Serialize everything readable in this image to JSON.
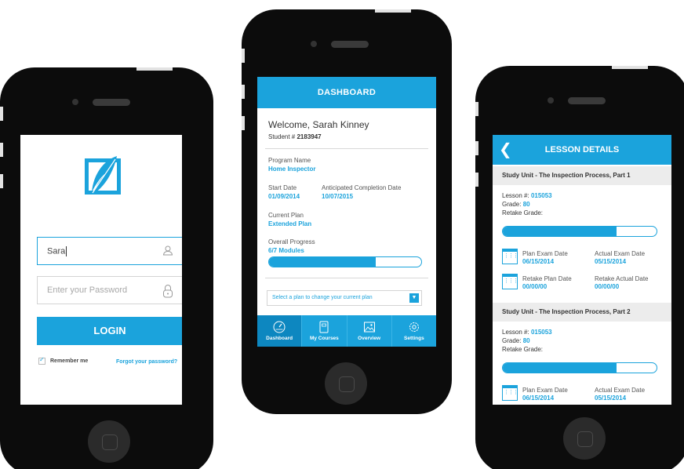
{
  "login": {
    "username_value": "Sara",
    "password_placeholder": "Enter your Password",
    "login_button": "LOGIN",
    "remember_me": "Remember me",
    "forgot_password": "Forgot your password?"
  },
  "dashboard": {
    "title": "DASHBOARD",
    "welcome": "Welcome, Sarah Kinney",
    "student_label": "Student #",
    "student_number": "2183947",
    "program_label": "Program Name",
    "program_value": "Home Inspector",
    "start_label": "Start Date",
    "start_value": "01/09/2014",
    "completion_label": "Anticipated Completion Date",
    "completion_value": "10/07/2015",
    "plan_label": "Current Plan",
    "plan_value": "Extended Plan",
    "progress_label": "Overall Progress",
    "progress_value": "6/7 Modules",
    "progress_fraction": 0.7,
    "select_placeholder": "Select a plan to change your current plan",
    "tabs": [
      {
        "label": "Dashboard",
        "icon": "gauge-icon",
        "active": true
      },
      {
        "label": "My Courses",
        "icon": "book-icon",
        "active": false
      },
      {
        "label": "Overview",
        "icon": "picture-icon",
        "active": false
      },
      {
        "label": "Settings",
        "icon": "gear-icon",
        "active": false
      }
    ]
  },
  "lesson": {
    "title": "LESSON DETAILS",
    "units": [
      {
        "name": "Study Unit - The Inspection Process, Part 1",
        "lesson_label": "Lesson #:",
        "lesson_number": "015053",
        "grade_label": "Grade:",
        "grade": "80",
        "retake_label": "Retake Grade:",
        "progress_fraction": 0.74,
        "plan_exam_label": "Plan Exam Date",
        "plan_exam_date": "06/15/2014",
        "actual_exam_label": "Actual Exam Date",
        "actual_exam_date": "05/15/2014",
        "retake_plan_label": "Retake Plan Date",
        "retake_plan_date": "00/00/00",
        "retake_actual_label": "Retake Actual Date",
        "retake_actual_date": "00/00/00"
      },
      {
        "name": "Study Unit - The Inspection Process, Part 2",
        "lesson_label": "Lesson #:",
        "lesson_number": "015053",
        "grade_label": "Grade:",
        "grade": "80",
        "retake_label": "Retake Grade:",
        "progress_fraction": 0.74,
        "plan_exam_label": "Plan Exam Date",
        "plan_exam_date": "06/15/2014",
        "actual_exam_label": "Actual Exam Date",
        "actual_exam_date": "05/15/2014"
      }
    ]
  },
  "colors": {
    "accent": "#1ba3dc",
    "accent_dark": "#0d87c0",
    "phone_body": "#0c0c0c"
  }
}
